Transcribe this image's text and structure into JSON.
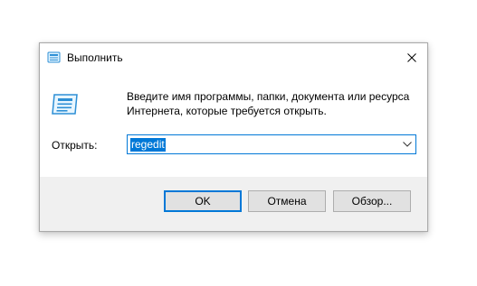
{
  "window": {
    "title": "Выполнить",
    "title_icon": "run-icon",
    "close_icon": "close-icon"
  },
  "description": {
    "line1": "Введите имя программы, папки, документа или ресурса",
    "line2": "Интернета, которые требуется открыть."
  },
  "open": {
    "label": "Открыть:",
    "value": "regedit",
    "dropdown_icon": "chevron-down-icon"
  },
  "buttons": {
    "ok": "OK",
    "cancel": "Отмена",
    "browse": "Обзор..."
  },
  "colors": {
    "accent": "#0078d7",
    "dialog_bg": "#f0f0f0",
    "content_bg": "#ffffff",
    "button_bg": "#e1e1e1"
  }
}
